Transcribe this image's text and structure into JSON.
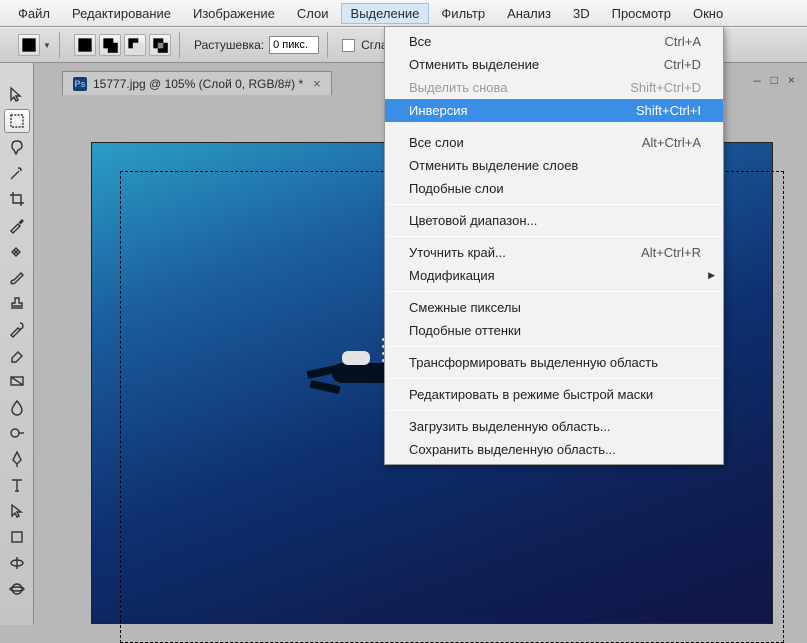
{
  "menubar": {
    "file": "Файл",
    "edit": "Редактирование",
    "image": "Изображение",
    "layer": "Слои",
    "select": "Выделение",
    "filter": "Фильтр",
    "analysis": "Анализ",
    "threeD": "3D",
    "view": "Просмотр",
    "window": "Окно"
  },
  "toolbar": {
    "feather_label": "Растушевка:",
    "feather_value": "0 пикс.",
    "antialias_label": "Сгладить"
  },
  "document": {
    "title": "15777.jpg @ 105% (Слой 0, RGB/8#) *"
  },
  "dropdown": {
    "all": {
      "label": "Все",
      "shortcut": "Ctrl+A"
    },
    "deselect": {
      "label": "Отменить выделение",
      "shortcut": "Ctrl+D"
    },
    "reselect": {
      "label": "Выделить снова",
      "shortcut": "Shift+Ctrl+D"
    },
    "inverse": {
      "label": "Инверсия",
      "shortcut": "Shift+Ctrl+I"
    },
    "all_layers": {
      "label": "Все слои",
      "shortcut": "Alt+Ctrl+A"
    },
    "deselect_layers": {
      "label": "Отменить выделение слоев"
    },
    "similar_layers": {
      "label": "Подобные слои"
    },
    "color_range": {
      "label": "Цветовой диапазон..."
    },
    "refine_edge": {
      "label": "Уточнить край...",
      "shortcut": "Alt+Ctrl+R"
    },
    "modify": {
      "label": "Модификация"
    },
    "grow": {
      "label": "Смежные пикселы"
    },
    "similar": {
      "label": "Подобные оттенки"
    },
    "transform": {
      "label": "Трансформировать выделенную область"
    },
    "quick_mask": {
      "label": "Редактировать в режиме быстрой маски"
    },
    "load": {
      "label": "Загрузить выделенную область..."
    },
    "save": {
      "label": "Сохранить выделенную область..."
    }
  }
}
